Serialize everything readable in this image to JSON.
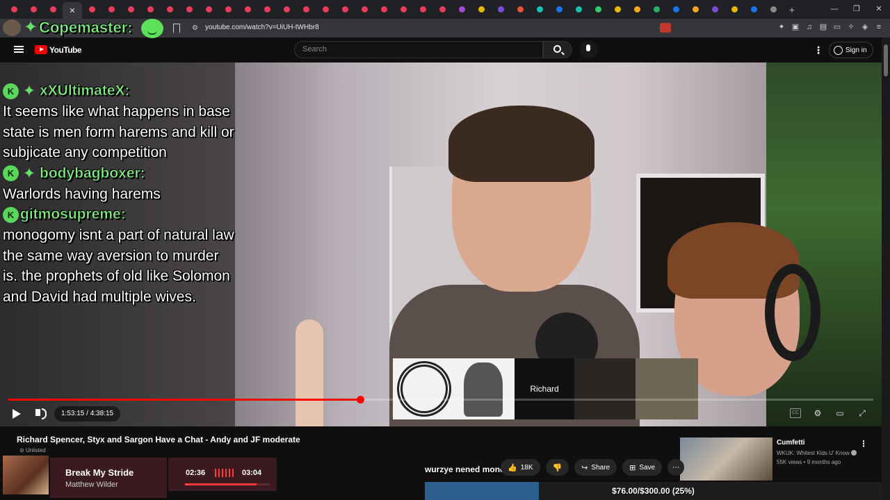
{
  "browser": {
    "url": "youtube.com/watch?v=UiUH-tWHbr8",
    "tab_colors": [
      "#e83c5a",
      "#e83c5a",
      "#e83c5a",
      "#e83c5a",
      "#e83c5a",
      "#e83c5a",
      "#e83c5a",
      "#e83c5a",
      "#e83c5a",
      "#e83c5a",
      "#e83c5a",
      "#e83c5a",
      "#e83c5a",
      "#e83c5a",
      "#e83c5a",
      "#e83c5a",
      "#e83c5a",
      "#e83c5a",
      "#e83c5a",
      "#e83c5a",
      "#e83c5a",
      "#e83c5a",
      "#e83c5a",
      "#a64bd6",
      "#e6b800",
      "#7b4bd6",
      "#e8543c",
      "#19c2b2",
      "#1a73e8",
      "#19c2b2",
      "#2ecc71",
      "#e6b800",
      "#f5a623",
      "#27ae60",
      "#1a73e8",
      "#f5a623",
      "#7b4bd6",
      "#e6b800",
      "#1a73e8",
      "#888888"
    ]
  },
  "youtube": {
    "logo_text": "YouTube",
    "search_placeholder": "Search",
    "sign_in_label": "Sign in"
  },
  "chat": {
    "top_user": "Copemaster:",
    "messages": [
      {
        "user": "xXUltimateX:",
        "text": "It seems like what happens in base state is men form harems and kill or subjicate any competition"
      },
      {
        "user": "bodybagboxer:",
        "text": "Warlords having harems"
      },
      {
        "user": "gitmosupreme:",
        "text": "monogomy isnt a part of natural law the same way aversion to murder is. the prophets of old like Solomon and David had multiple wives."
      }
    ]
  },
  "overlay": {
    "participant_name": "Richard"
  },
  "player": {
    "time_display": "1:53:15 / 4:38:15",
    "progress_fraction": 0.4068
  },
  "video": {
    "title": "Richard Spencer, Styx and Sargon Have a Chat - Andy and JF moderate",
    "visibility": "Unlisted"
  },
  "actions": {
    "like_count": "18K",
    "share_label": "Share",
    "save_label": "Save"
  },
  "now_playing": {
    "song": "Break My Stride",
    "artist": "Matthew Wilder",
    "current": "02:36",
    "total": "03:04",
    "progress_fraction": 0.848
  },
  "donation": {
    "message": "wurzye nened money",
    "goal_text": "$76.00/$300.00 (25%)",
    "goal_fraction": 0.25
  },
  "recommended": {
    "title": "Cumfetti",
    "channel": "WKUK: Whitest Kids U' Know",
    "meta": "55K views • 9 months ago"
  }
}
